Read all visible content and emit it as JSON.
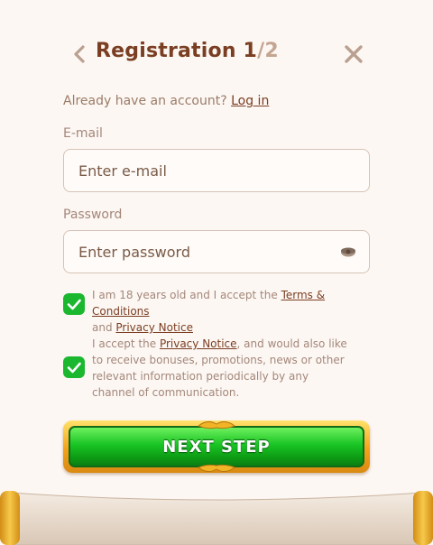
{
  "header": {
    "title_main": "Registration 1",
    "title_sep": "/",
    "title_total": "2"
  },
  "login": {
    "prompt": "Already have an account?",
    "link": "Log in"
  },
  "email": {
    "label": "E-mail",
    "placeholder": "Enter e-mail",
    "value": ""
  },
  "password": {
    "label": "Password",
    "placeholder": "Enter password",
    "value": ""
  },
  "consent_age": {
    "checked": true,
    "text_before": "I am 18 years old and I accept the ",
    "link1": "Terms & Conditions",
    "text_mid": "and ",
    "link2": "Privacy Notice"
  },
  "consent_marketing": {
    "checked": true,
    "text_before": "I accept the ",
    "link": "Privacy Notice",
    "text_after": ", and would also like to receive bonuses, promotions, news or other relevant information periodically by any channel of communication."
  },
  "next_button": {
    "label": "NEXT STEP"
  },
  "colors": {
    "accent_brown": "#7a3e22",
    "checkbox_green": "#1bb82f",
    "button_green": "#19c424",
    "button_gold": "#f3a21c"
  },
  "icons": [
    "chevron-left-icon",
    "close-icon",
    "eye-icon",
    "checkmark-icon"
  ]
}
